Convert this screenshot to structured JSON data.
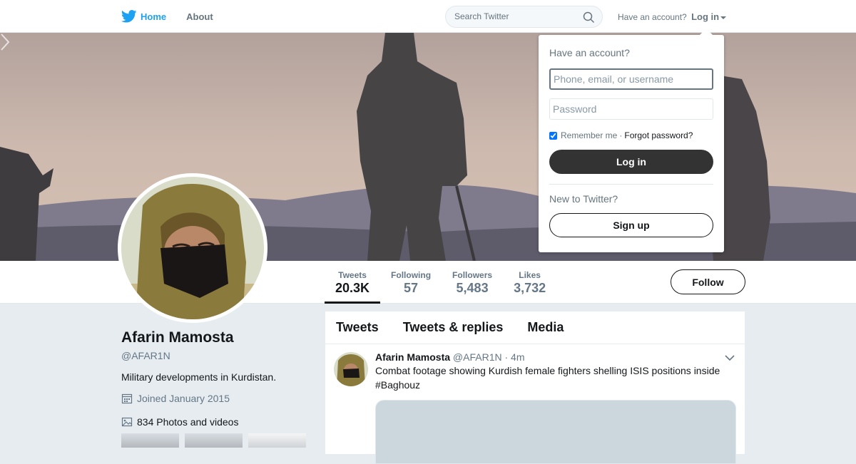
{
  "topbar": {
    "home_label": "Home",
    "about_label": "About",
    "search_placeholder": "Search Twitter",
    "have_account_text": "Have an account?",
    "login_label": "Log in"
  },
  "profile": {
    "name": "Afarin Mamosta",
    "handle": "@AFAR1N",
    "bio": "Military developments in Kurdistan.",
    "joined": "Joined January 2015",
    "photos": "834 Photos and videos"
  },
  "stats": [
    {
      "label": "Tweets",
      "value": "20.3K"
    },
    {
      "label": "Following",
      "value": "57"
    },
    {
      "label": "Followers",
      "value": "5,483"
    },
    {
      "label": "Likes",
      "value": "3,732"
    }
  ],
  "follow_label": "Follow",
  "timeline": {
    "tabs": [
      "Tweets",
      "Tweets & replies",
      "Media"
    ],
    "tweet": {
      "name": "Afarin Mamosta",
      "handle": "@AFAR1N",
      "time": "· 4m",
      "text": "Combat footage showing Kurdish female fighters shelling ISIS positions inside #Baghouz"
    }
  },
  "login_dropdown": {
    "title": "Have an account?",
    "username_placeholder": "Phone, email, or username",
    "password_placeholder": "Password",
    "remember_label": "Remember me",
    "separator": "·",
    "forgot_label": "Forgot password?",
    "login_button": "Log in",
    "new_text": "New to Twitter?",
    "signup_button": "Sign up"
  },
  "colors": {
    "brand": "#1da1f2",
    "text_primary": "#14171a",
    "text_secondary": "#657786",
    "background": "#e6ecf0"
  },
  "icons": [
    "twitter-bird-icon",
    "search-icon",
    "caret-down-icon",
    "calendar-icon",
    "image-icon",
    "chevron-down-icon",
    "chevron-right-icon"
  ]
}
